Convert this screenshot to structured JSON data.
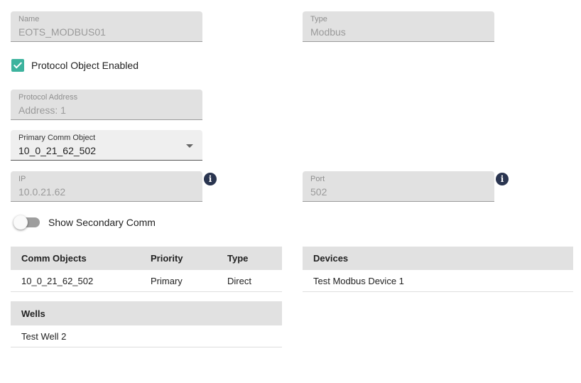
{
  "name_field": {
    "label": "Name",
    "value": "EOTS_MODBUS01"
  },
  "type_field": {
    "label": "Type",
    "value": "Modbus"
  },
  "enabled_checkbox": {
    "label": "Protocol Object Enabled",
    "checked": true
  },
  "protocol_address": {
    "label": "Protocol Address",
    "value": "Address: 1"
  },
  "primary_comm": {
    "label": "Primary Comm Object",
    "value": "10_0_21_62_502"
  },
  "ip_field": {
    "label": "IP",
    "value": "10.0.21.62",
    "info_icon": "i"
  },
  "port_field": {
    "label": "Port",
    "value": "502",
    "info_icon": "i"
  },
  "secondary_toggle": {
    "label": "Show Secondary Comm",
    "on": false
  },
  "comm_table": {
    "headers": [
      "Comm Objects",
      "Priority",
      "Type"
    ],
    "rows": [
      [
        "10_0_21_62_502",
        "Primary",
        "Direct"
      ]
    ]
  },
  "devices_table": {
    "headers": [
      "Devices"
    ],
    "rows": [
      [
        "Test Modbus Device 1"
      ]
    ]
  },
  "wells_table": {
    "headers": [
      "Wells"
    ],
    "rows": [
      [
        "Test Well 2"
      ]
    ]
  },
  "colors": {
    "accent_checkbox": "#3db39e",
    "info_icon": "#2a3550",
    "field_background": "#e1e1e1"
  }
}
